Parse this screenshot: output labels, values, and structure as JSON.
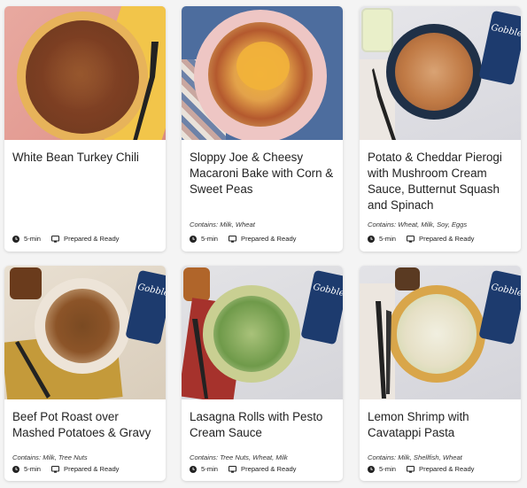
{
  "labels": {
    "time": "5-min",
    "prepared": "Prepared & Ready",
    "brand": "Gobble"
  },
  "meals": [
    {
      "title": "White Bean Turkey Chili",
      "contains": ""
    },
    {
      "title": "Sloppy Joe & Cheesy Macaroni Bake with Corn & Sweet Peas",
      "contains": "Contains: Milk, Wheat"
    },
    {
      "title": "Potato & Cheddar Pierogi with Mushroom Cream Sauce, Butternut Squash and Spinach",
      "contains": "Contains: Wheat, Milk, Soy, Eggs"
    },
    {
      "title": "Beef Pot Roast over Mashed Potatoes & Gravy",
      "contains": "Contains: Milk, Tree Nuts"
    },
    {
      "title": "Lasagna Rolls with Pesto Cream Sauce",
      "contains": "Contains: Tree Nuts, Wheat, Milk"
    },
    {
      "title": "Lemon Shrimp with Cavatappi Pasta",
      "contains": "Contains: Milk, Shellfish, Wheat"
    }
  ],
  "colors": {
    "brand_box": "#1d3b6e",
    "text": "#222222",
    "background": "#f4f4f4"
  },
  "icons": {
    "time": "clock-icon",
    "prepared": "screen-icon"
  }
}
